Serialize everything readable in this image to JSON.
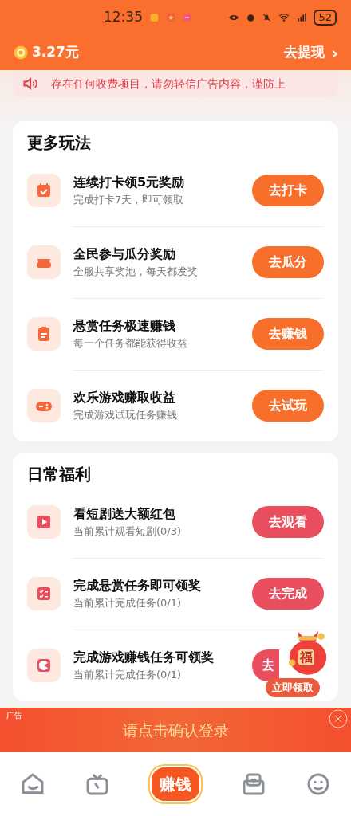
{
  "status_bar": {
    "time": "12:35",
    "battery": "52"
  },
  "header": {
    "balance": "3.27元",
    "withdraw": "去提现",
    "chevron": "›"
  },
  "notice": {
    "text": "存在任何收费项目，请勿轻信广告内容，谨防上"
  },
  "sections": [
    {
      "title": "更多玩法",
      "items": [
        {
          "title": "连续打卡领5元奖励",
          "subtitle": "完成打卡7天，即可领取",
          "button": "去打卡",
          "kind": "orange"
        },
        {
          "title": "全民参与瓜分奖励",
          "subtitle": "全服共享奖池，每天都发奖",
          "button": "去瓜分",
          "kind": "orange"
        },
        {
          "title": "悬赏任务极速赚钱",
          "subtitle": "每一个任务都能获得收益",
          "button": "去赚钱",
          "kind": "orange"
        },
        {
          "title": "欢乐游戏赚取收益",
          "subtitle": "完成游戏试玩任务赚钱",
          "button": "去试玩",
          "kind": "orange"
        }
      ]
    },
    {
      "title": "日常福利",
      "items": [
        {
          "title": "看短剧送大额红包",
          "subtitle": "当前累计观看短剧(0/3)",
          "button": "去观看",
          "kind": "red"
        },
        {
          "title": "完成悬赏任务即可领奖",
          "subtitle": "当前累计完成任务(0/1)",
          "button": "去完成",
          "kind": "red"
        },
        {
          "title": "完成游戏赚钱任务可领奖",
          "subtitle": "当前累计完成任务(0/1)",
          "button": "去",
          "kind": "red"
        }
      ]
    }
  ],
  "float_bag": {
    "mark": "福",
    "label": "立即领取"
  },
  "ad": {
    "tag": "广告",
    "text": "请点击确认登录"
  },
  "nav": {
    "center": "赚钱"
  }
}
